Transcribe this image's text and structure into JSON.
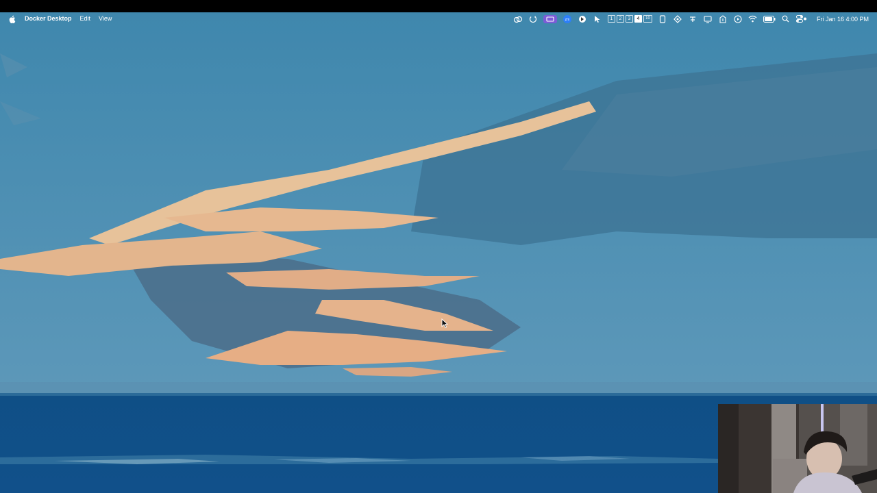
{
  "menubar": {
    "app_name": "Docker Desktop",
    "menus": [
      "Edit",
      "View"
    ],
    "spaces": [
      "1",
      "2",
      "3",
      "4",
      "10"
    ],
    "active_space": "4",
    "clock": "Fri Jan 16  4:00 PM",
    "status_icons": [
      "creative-cloud-icon",
      "sync-icon",
      "screen-record-icon",
      "zoom-icon",
      "browser-extension-icon",
      "pointer-icon",
      "app-icon-1",
      "app-icon-2",
      "app-icon-3",
      "display-icon",
      "vpn-icon",
      "play-icon",
      "wifi-icon",
      "battery-icon",
      "spotlight-icon",
      "control-center-icon"
    ]
  },
  "desktop": {
    "wallpaper": "sky-and-sea-illustration",
    "colors": {
      "sky": "#4b8bb0",
      "sea": "#0f4f86",
      "cloud": "#e6b48c"
    }
  },
  "webcam": {
    "label": "webcam-overlay"
  }
}
